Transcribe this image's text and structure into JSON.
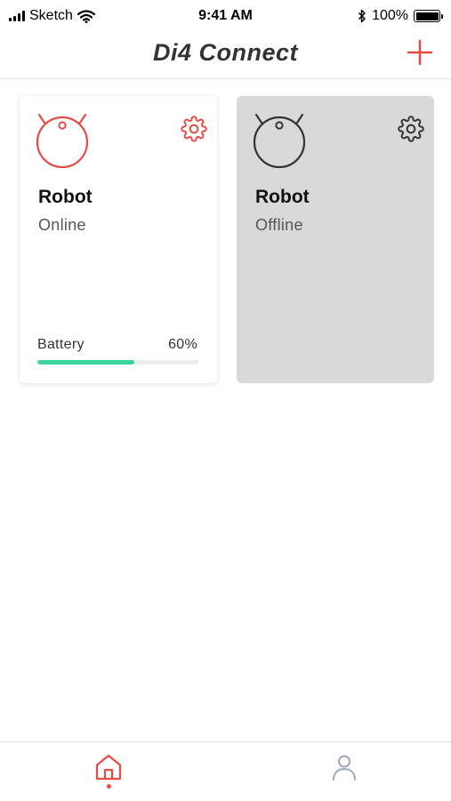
{
  "status_bar": {
    "carrier": "Sketch",
    "time": "9:41 AM",
    "battery": "100%",
    "icons": [
      "signal-icon",
      "wifi-icon",
      "bluetooth-icon",
      "battery-icon"
    ]
  },
  "header": {
    "title": "Di4 Connect",
    "add_icon": "plus-icon"
  },
  "devices": [
    {
      "name": "Robot",
      "status": "Online",
      "battery_label": "Battery",
      "battery_value": "60%",
      "battery_level": 0.6,
      "icon": "robot-vacuum-icon",
      "settings_icon": "gear-icon",
      "color": "#e84c48"
    },
    {
      "name": "Robot",
      "status": "Offline",
      "icon": "robot-vacuum-icon",
      "settings_icon": "gear-icon",
      "color": "#333333"
    }
  ],
  "tab_bar": {
    "tabs": [
      {
        "icon": "home-icon",
        "active": true
      },
      {
        "icon": "profile-icon",
        "active": false
      }
    ]
  },
  "colors": {
    "accent": "#e84c48",
    "battery_bar": "#3dd39d",
    "offline_card": "#d9d9d9",
    "inactive_tab": "#9fa8bf"
  }
}
